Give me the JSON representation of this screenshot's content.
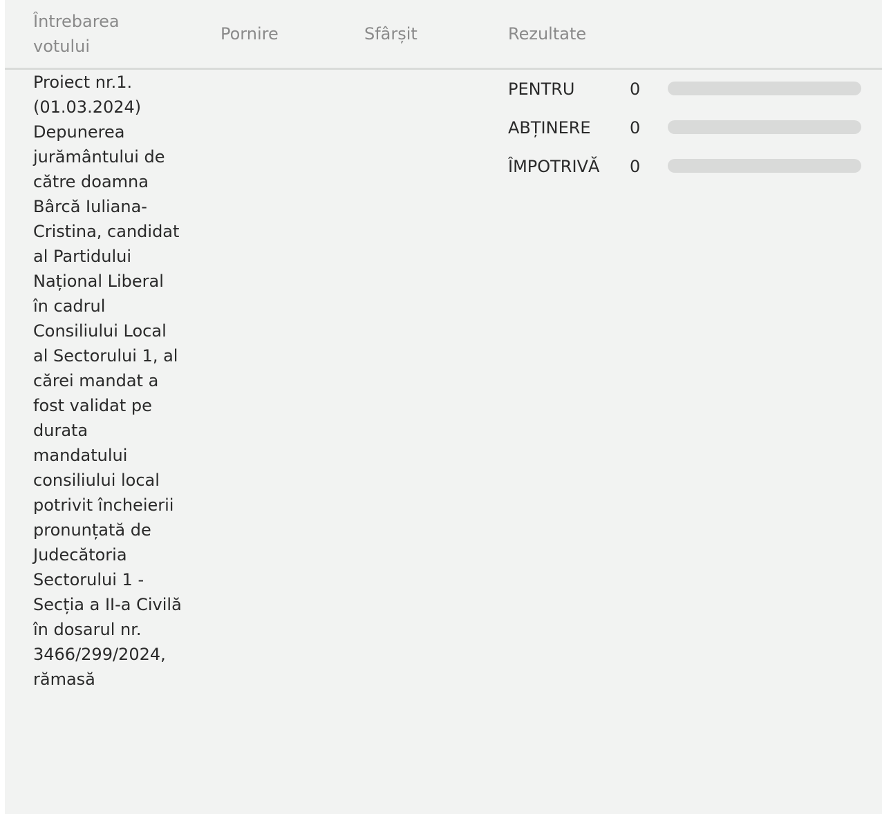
{
  "table": {
    "headers": {
      "question": "Întrebarea votului",
      "start": "Pornire",
      "end": "Sfârșit",
      "results": "Rezultate"
    },
    "row": {
      "question": "Proiect nr.1. (01.03.2024) Depunerea jurământului de către doamna Bârcă Iuliana-Cristina, candidat al Partidului Național Liberal în cadrul Consiliului Local al Sectorului 1, al cărei mandat a fost validat pe durata mandatului consiliului local potrivit încheierii pronunțată de Judecătoria Sectorului 1 - Secția a II-a Civilă în dosarul nr. 3466/299/2024, rămasă",
      "start": "",
      "end": "",
      "results": [
        {
          "label": "PENTRU",
          "count": "0",
          "fraction": 0
        },
        {
          "label": "ABȚINERE",
          "count": "0",
          "fraction": 0
        },
        {
          "label": "ÎMPOTRIVĂ",
          "count": "0",
          "fraction": 0
        }
      ]
    }
  },
  "colors": {
    "panel_bg": "#f2f3f2",
    "bar_track": "#d9dad9",
    "header_text": "#8a8a8a"
  }
}
